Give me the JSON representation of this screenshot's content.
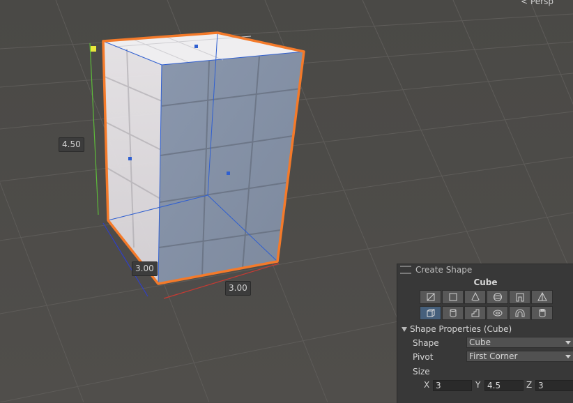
{
  "viewport": {
    "camera_mode": "< Persp",
    "dimensions": {
      "height": "4.50",
      "depth": "3.00",
      "width": "3.00"
    }
  },
  "panel": {
    "title": "Create Shape",
    "shape_name": "Cube",
    "shape_buttons_row1": [
      "plane-icon",
      "quad-icon",
      "cone-icon",
      "sphere-icon",
      "arch-door-icon",
      "prism-icon"
    ],
    "shape_buttons_row2": [
      "cube-icon",
      "cylinder-icon",
      "stairs-icon",
      "torus-icon",
      "arch-icon",
      "pipe-icon"
    ],
    "active_shape": "cube-icon",
    "section_title": "Shape Properties (Cube)",
    "shape_label": "Shape",
    "shape_value": "Cube",
    "pivot_label": "Pivot",
    "pivot_value": "First Corner",
    "size_label": "Size",
    "size": {
      "x_label": "X",
      "x": "3",
      "y_label": "Y",
      "y": "4.5",
      "z_label": "Z",
      "z": "3"
    }
  },
  "colors": {
    "outline": "#f47a2a",
    "edges": "#2f5fd0",
    "axis_red": "#c83a33",
    "axis_green": "#5dbb3a",
    "axis_blue": "#2f3fc8",
    "handle": "#e8e83a"
  }
}
